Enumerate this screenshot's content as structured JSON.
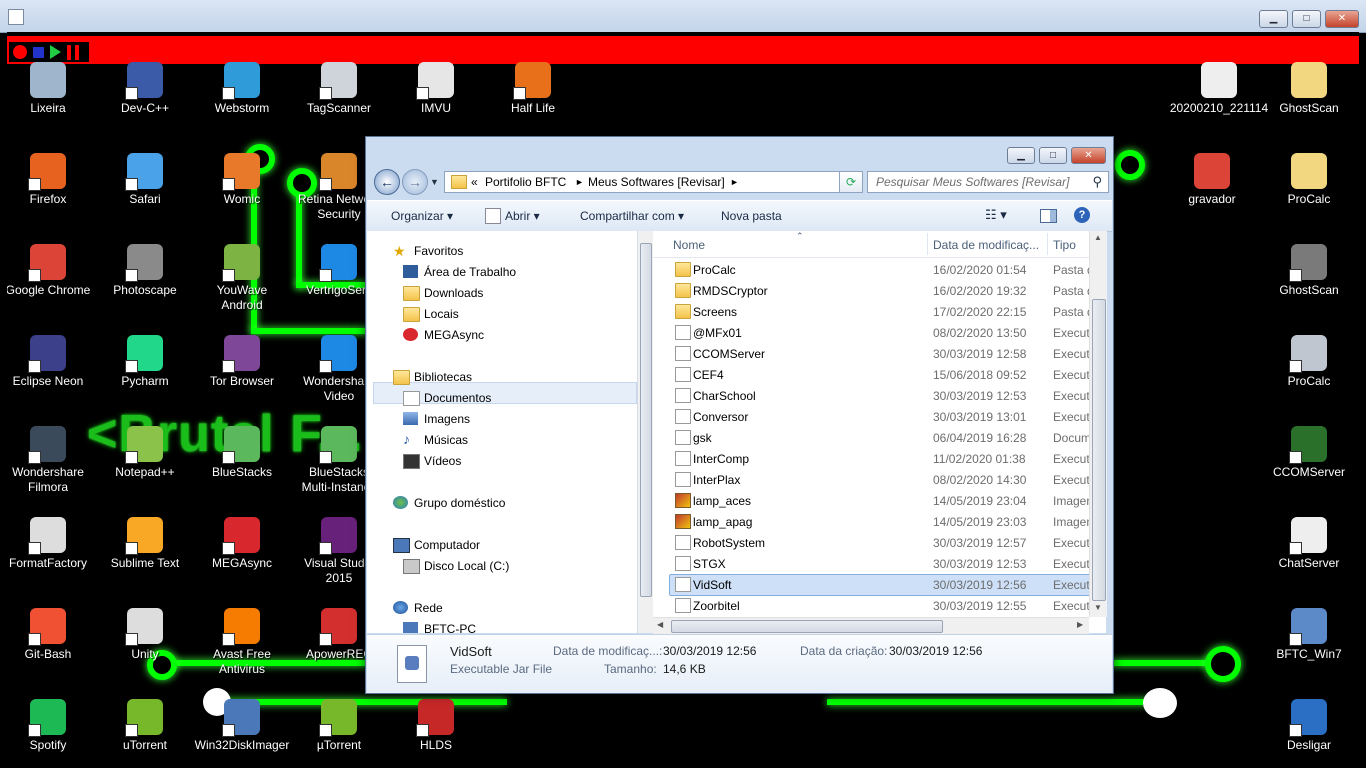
{
  "desktop": {
    "banner_text": "<Brutal F... ...tions>",
    "icons": [
      {
        "label": "Lixeira",
        "color": "#9fb5cc"
      },
      {
        "label": "Dev-C++",
        "color": "#3b5aa8"
      },
      {
        "label": "Webstorm",
        "color": "#2f9bd8"
      },
      {
        "label": "TagScanner",
        "color": "#cfd4da"
      },
      {
        "label": "IMVU",
        "color": "#e6e6e6"
      },
      {
        "label": "Half Life",
        "color": "#e8701a"
      },
      {
        "label": "20200210_221114",
        "color": "#eeeeee"
      },
      {
        "label": "GhostScan",
        "color": "#f2d680"
      },
      {
        "label": "Firefox",
        "color": "#e8621f"
      },
      {
        "label": "Safari",
        "color": "#4aa3e8"
      },
      {
        "label": "Womic",
        "color": "#e8792a"
      },
      {
        "label": "Retina Network Security Scanner",
        "color": "#d9852a"
      },
      {
        "label": "gravador",
        "color": "#db4437"
      },
      {
        "label": "ProCalc",
        "color": "#f2d680"
      },
      {
        "label": "Google Chrome",
        "color": "#db4437"
      },
      {
        "label": "Photoscape",
        "color": "#8a8a8a"
      },
      {
        "label": "YouWave Android",
        "color": "#7cb342"
      },
      {
        "label": "VertrigoServ",
        "color": "#1e88e5"
      },
      {
        "label": "GhostScan",
        "color": "#7a7a7a"
      },
      {
        "label": "Eclipse Neon",
        "color": "#3c3f8a"
      },
      {
        "label": "Pycharm",
        "color": "#21d789"
      },
      {
        "label": "Tor Browser",
        "color": "#7e4798"
      },
      {
        "label": "Wondershare Video Converter",
        "color": "#1e88e5"
      },
      {
        "label": "ProCalc",
        "color": "#c0c6cf"
      },
      {
        "label": "Wondershare Filmora",
        "color": "#3a4a5a"
      },
      {
        "label": "Notepad++",
        "color": "#8bc34a"
      },
      {
        "label": "BlueStacks",
        "color": "#5cb85c"
      },
      {
        "label": "BlueStacks Multi-Instance",
        "color": "#5cb85c"
      },
      {
        "label": "CCOMServer",
        "color": "#2a6f2a"
      },
      {
        "label": "FormatFactory",
        "color": "#dddddd"
      },
      {
        "label": "Sublime Text",
        "color": "#f9a825"
      },
      {
        "label": "MEGAsync",
        "color": "#d9272e"
      },
      {
        "label": "Visual Studio 2015",
        "color": "#68217a"
      },
      {
        "label": "ChatServer",
        "color": "#eeeeee"
      },
      {
        "label": "Git-Bash",
        "color": "#f05133"
      },
      {
        "label": "Unity",
        "color": "#dddddd"
      },
      {
        "label": "Avast Free Antivirus",
        "color": "#f57c00"
      },
      {
        "label": "ApowerREC",
        "color": "#d32f2f"
      },
      {
        "label": "BFTC_Win7",
        "color": "#5c8ac9"
      },
      {
        "label": "Spotify",
        "color": "#1db954"
      },
      {
        "label": "uTorrent",
        "color": "#76b82a"
      },
      {
        "label": "Win32DiskImager",
        "color": "#4a78b8"
      },
      {
        "label": "µTorrent",
        "color": "#76b82a"
      },
      {
        "label": "HLDS",
        "color": "#c62828"
      },
      {
        "label": "Desligar",
        "color": "#2a6fc4"
      }
    ]
  },
  "explorer": {
    "title": "",
    "address": {
      "prefix": "«",
      "crumbs": [
        "Portifolio BFTC",
        "Meus Softwares [Revisar]"
      ],
      "separator": "►"
    },
    "search_placeholder": "Pesquisar Meus Softwares [Revisar]",
    "toolbar": {
      "organize": "Organizar ▾",
      "open": "Abrir ▾",
      "share": "Compartilhar com ▾",
      "new_folder": "Nova pasta"
    },
    "nav_pane": {
      "favorites": "Favoritos",
      "desktop": "Área de Trabalho",
      "downloads": "Downloads",
      "locais": "Locais",
      "megasync": "MEGAsync",
      "libraries": "Bibliotecas",
      "documents": "Documentos",
      "images": "Imagens",
      "music": "Músicas",
      "videos": "Vídeos",
      "homegroup": "Grupo doméstico",
      "computer": "Computador",
      "local_disk": "Disco Local (C:)",
      "network": "Rede",
      "pc": "BFTC-PC"
    },
    "columns": {
      "name": "Nome",
      "date": "Data de modificaç...",
      "type": "Tipo"
    },
    "files": [
      {
        "name": "ProCalc",
        "date": "16/02/2020 01:54",
        "type": "Pasta de",
        "kind": "folder"
      },
      {
        "name": "RMDSCryptor",
        "date": "16/02/2020 19:32",
        "type": "Pasta de",
        "kind": "folder"
      },
      {
        "name": "Screens",
        "date": "17/02/2020 22:15",
        "type": "Pasta de",
        "kind": "folder"
      },
      {
        "name": "@MFx01",
        "date": "08/02/2020 13:50",
        "type": "Executa",
        "kind": "doc"
      },
      {
        "name": "CCOMServer",
        "date": "30/03/2019 12:58",
        "type": "Executa",
        "kind": "doc"
      },
      {
        "name": "CEF4",
        "date": "15/06/2018 09:52",
        "type": "Executa",
        "kind": "doc"
      },
      {
        "name": "CharSchool",
        "date": "30/03/2019 12:53",
        "type": "Executa",
        "kind": "doc"
      },
      {
        "name": "Conversor",
        "date": "30/03/2019 13:01",
        "type": "Executa",
        "kind": "doc"
      },
      {
        "name": "gsk",
        "date": "06/04/2019 16:28",
        "type": "Docum",
        "kind": "doc"
      },
      {
        "name": "InterComp",
        "date": "11/02/2020 01:38",
        "type": "Executa",
        "kind": "doc"
      },
      {
        "name": "InterPlax",
        "date": "08/02/2020 14:30",
        "type": "Executa",
        "kind": "doc"
      },
      {
        "name": "lamp_aces",
        "date": "14/05/2019 23:04",
        "type": "Imagem",
        "kind": "img"
      },
      {
        "name": "lamp_apag",
        "date": "14/05/2019 23:03",
        "type": "Imagem",
        "kind": "img"
      },
      {
        "name": "RobotSystem",
        "date": "30/03/2019 12:57",
        "type": "Executa",
        "kind": "doc"
      },
      {
        "name": "STGX",
        "date": "30/03/2019 12:53",
        "type": "Executa",
        "kind": "doc"
      },
      {
        "name": "VidSoft",
        "date": "30/03/2019 12:56",
        "type": "Executa",
        "kind": "doc",
        "selected": true
      },
      {
        "name": "Zoorbitel",
        "date": "30/03/2019 12:55",
        "type": "Executa",
        "kind": "doc"
      }
    ],
    "details": {
      "name": "VidSoft",
      "kind": "Executable Jar File",
      "modified_label": "Data de modificaç...:",
      "modified_value": "30/03/2019 12:56",
      "created_label": "Data da criação:",
      "created_value": "30/03/2019 12:56",
      "size_label": "Tamanho:",
      "size_value": "14,6 KB"
    }
  }
}
